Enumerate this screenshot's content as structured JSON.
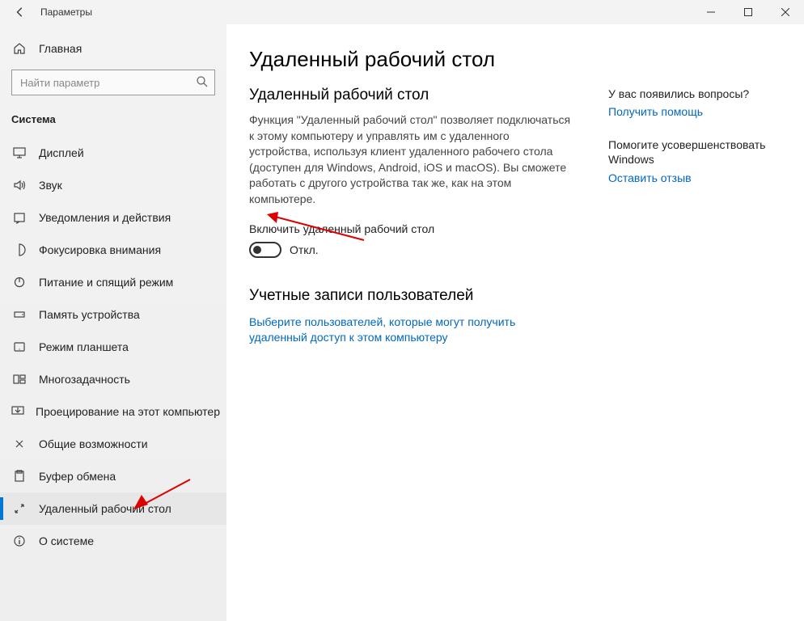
{
  "titlebar": {
    "title": "Параметры"
  },
  "sidebar": {
    "home": "Главная",
    "search_placeholder": "Найти параметр",
    "category": "Система",
    "items": [
      {
        "label": "Дисплей",
        "icon": "display-icon"
      },
      {
        "label": "Звук",
        "icon": "sound-icon"
      },
      {
        "label": "Уведомления и действия",
        "icon": "notifications-icon"
      },
      {
        "label": "Фокусировка внимания",
        "icon": "focus-icon"
      },
      {
        "label": "Питание и спящий режим",
        "icon": "power-icon"
      },
      {
        "label": "Память устройства",
        "icon": "storage-icon"
      },
      {
        "label": "Режим планшета",
        "icon": "tablet-icon"
      },
      {
        "label": "Многозадачность",
        "icon": "multitask-icon"
      },
      {
        "label": "Проецирование на этот компьютер",
        "icon": "project-icon"
      },
      {
        "label": "Общие возможности",
        "icon": "shared-icon"
      },
      {
        "label": "Буфер обмена",
        "icon": "clipboard-icon"
      },
      {
        "label": "Удаленный рабочий стол",
        "icon": "remote-icon",
        "active": true
      },
      {
        "label": "О системе",
        "icon": "about-icon"
      }
    ]
  },
  "page": {
    "title": "Удаленный рабочий стол",
    "section1_title": "Удаленный рабочий стол",
    "description": "Функция \"Удаленный рабочий стол\" позволяет подключаться к этому компьютеру и управлять им с удаленного устройства, используя клиент удаленного рабочего стола (доступен для Windows, Android, iOS и macOS). Вы сможете работать с другого устройства так же, как на этом компьютере.",
    "toggle_label": "Включить удаленный рабочий стол",
    "toggle_state": "Откл.",
    "section2_title": "Учетные записи пользователей",
    "select_users_link": "Выберите пользователей, которые могут получить удаленный доступ к этом компьютеру"
  },
  "right": {
    "q1": "У вас появились вопросы?",
    "link1": "Получить помощь",
    "q2": "Помогите усовершенствовать Windows",
    "link2": "Оставить отзыв"
  }
}
